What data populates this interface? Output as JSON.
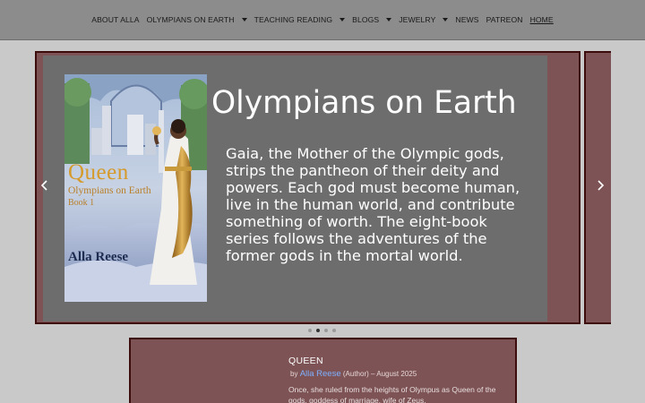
{
  "nav": {
    "items": [
      {
        "label": "ABOUT ALLA",
        "has_dropdown": false
      },
      {
        "label": "OLYMPIANS ON EARTH",
        "has_dropdown": true
      },
      {
        "label": "TEACHING READING",
        "has_dropdown": true
      },
      {
        "label": "BLOGS",
        "has_dropdown": true
      },
      {
        "label": "JEWELRY",
        "has_dropdown": true
      },
      {
        "label": "NEWS",
        "has_dropdown": false
      },
      {
        "label": "PATREON",
        "has_dropdown": false
      },
      {
        "label": "HOME",
        "has_dropdown": false,
        "active": true
      }
    ]
  },
  "carousel": {
    "prev_icon": "chevron-left-icon",
    "next_icon": "chevron-right-icon",
    "active_dot": 2,
    "dot_count": 4,
    "slide": {
      "heading": "Olympians on Earth",
      "description": "Gaia, the Mother of the Olympic gods, strips the pantheon of their deity and powers. Each god must become human, live in the human world, and contribute something of worth. The eight-book series follows the adventures of the former gods in the mortal world.",
      "cover": {
        "title": "Queen",
        "series": "Olympians on Earth",
        "book": "Book 1",
        "author": "Alla Reese"
      }
    }
  },
  "book_card": {
    "title": "QUEEN",
    "by": "by",
    "author": "Alla Reese",
    "role": "(Author)",
    "date": "– August 2025",
    "description": "Once, she ruled from the heights of Olympus as Queen of the gods, goddess of marriage, wife of Zeus."
  },
  "colors": {
    "nav_bg": "#8c8c8c",
    "page_bg": "#c9c9c9",
    "slide_frame": "#7d5355",
    "slide_border": "#3d0c0c",
    "slide_inner": "#6d6d6d",
    "link": "#7fb0ff"
  }
}
